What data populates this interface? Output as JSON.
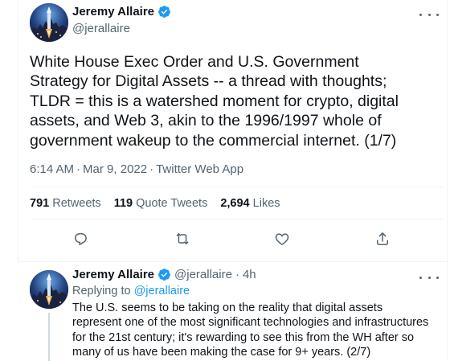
{
  "main_tweet": {
    "author_name": "Jeremy Allaire",
    "author_handle": "@jerallaire",
    "text": "White House Exec Order and U.S. Government\nStrategy for Digital Assets -- a thread with thoughts;\nTLDR = this is a watershed moment for crypto, digital\nassets, and Web 3, akin to the 1996/1997 whole of\ngovernment wakeup to the commercial internet. (1/7)",
    "time": "6:14 AM",
    "date": "Mar 9, 2022",
    "source": "Twitter Web App",
    "separator": "·",
    "stats": [
      {
        "value": "791",
        "label": "Retweets"
      },
      {
        "value": "119",
        "label": "Quote Tweets"
      },
      {
        "value": "2,694",
        "label": "Likes"
      }
    ]
  },
  "actions": [
    "reply-icon",
    "retweet-icon",
    "like-icon",
    "share-icon"
  ],
  "reply_tweet": {
    "author_name": "Jeremy Allaire",
    "author_handle": "@jerallaire",
    "separator": "·",
    "age": "4h",
    "replying_prefix": "Replying to",
    "replying_to": "@jerallaire",
    "text": "The U.S. seems to be taking on the reality that digital assets represent one of the most significant technologies and infrastructures for the 21st century; it's rewarding to see this from the WH after so many of us have been making the case for 9+ years. (2/7)"
  },
  "colors": {
    "accent": "#1d9bf0",
    "secondary_text": "#536471",
    "primary_text": "#0f1419",
    "divider": "#eff3f4"
  }
}
